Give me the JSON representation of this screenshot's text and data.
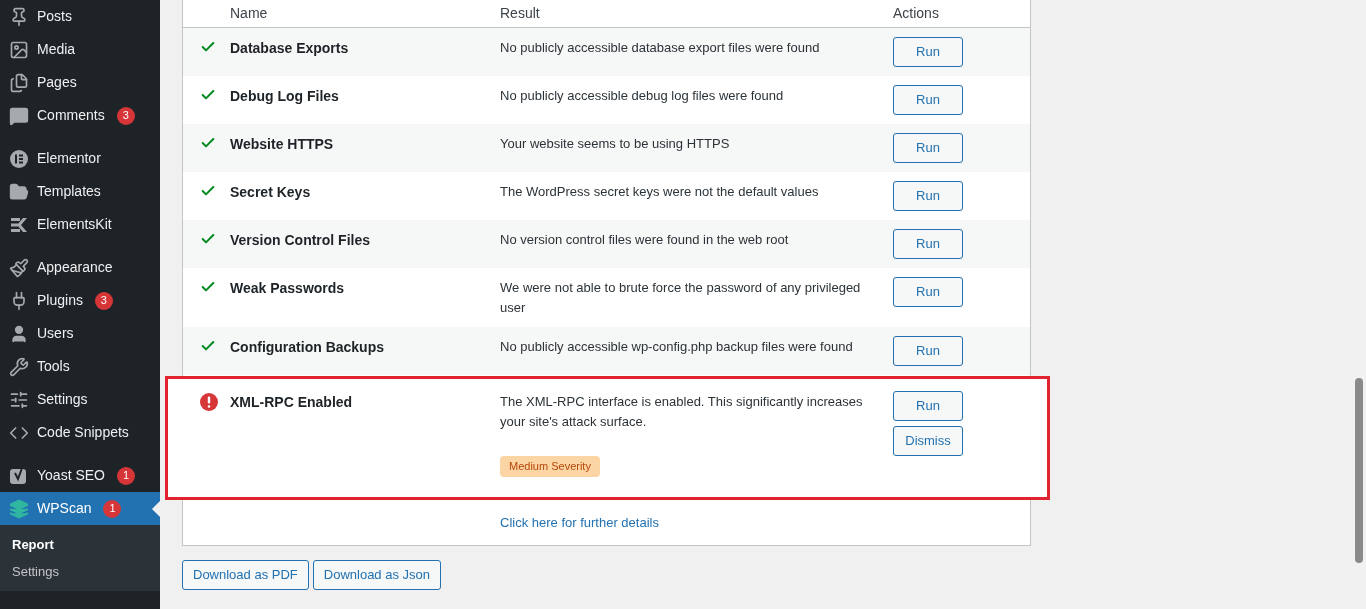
{
  "sidebar": {
    "groups": [
      {
        "items": [
          {
            "label": "Posts",
            "selected": false
          },
          {
            "label": "Media",
            "selected": false
          },
          {
            "label": "Pages",
            "selected": false
          },
          {
            "label": "Comments",
            "badge": "3",
            "selected": false
          }
        ]
      },
      {
        "items": [
          {
            "label": "Elementor",
            "selected": false
          },
          {
            "label": "Templates",
            "selected": false
          },
          {
            "label": "ElementsKit",
            "selected": false
          }
        ]
      },
      {
        "items": [
          {
            "label": "Appearance",
            "selected": false
          },
          {
            "label": "Plugins",
            "badge": "3",
            "selected": false
          },
          {
            "label": "Users",
            "selected": false
          },
          {
            "label": "Tools",
            "selected": false
          },
          {
            "label": "Settings",
            "selected": false
          },
          {
            "label": "Code Snippets",
            "selected": false
          }
        ]
      },
      {
        "items": [
          {
            "label": "Yoast SEO",
            "badge": "1",
            "selected": false
          },
          {
            "label": "WPScan",
            "badge": "1",
            "selected": true
          }
        ]
      }
    ],
    "submenu": [
      {
        "label": "Report",
        "selected": true
      },
      {
        "label": "Settings",
        "selected": false
      }
    ]
  },
  "table": {
    "columns": [
      "Name",
      "Result",
      "Actions"
    ],
    "rows": [
      {
        "kind": "pass",
        "name": "Database Exports",
        "result": "No publicly accessible database export files were found",
        "actions": [
          "Run"
        ],
        "highlighted": false
      },
      {
        "kind": "pass",
        "name": "Debug Log Files",
        "result": "No publicly accessible debug log files were found",
        "actions": [
          "Run"
        ],
        "highlighted": false
      },
      {
        "kind": "pass",
        "name": "Website HTTPS",
        "result": "Your website seems to be using HTTPS",
        "actions": [
          "Run"
        ],
        "highlighted": false
      },
      {
        "kind": "pass",
        "name": "Secret Keys",
        "result": "The WordPress secret keys were not the default values",
        "actions": [
          "Run"
        ],
        "highlighted": false
      },
      {
        "kind": "pass",
        "name": "Version Control Files",
        "result": "No version control files were found in the web root",
        "actions": [
          "Run"
        ],
        "highlighted": false
      },
      {
        "kind": "pass",
        "name": "Weak Passwords",
        "result": "We were not able to brute force the password of any privileged user",
        "actions": [
          "Run"
        ],
        "highlighted": false
      },
      {
        "kind": "pass",
        "name": "Configuration Backups",
        "result": "No publicly accessible wp-config.php backup files were found",
        "actions": [
          "Run"
        ],
        "highlighted": false
      },
      {
        "kind": "fail",
        "name": "XML-RPC Enabled",
        "result": "The XML-RPC interface is enabled. This significantly increases your site's attack surface.",
        "severity": "Medium Severity",
        "actions": [
          "Run",
          "Dismiss"
        ],
        "highlighted": true
      }
    ],
    "details_link": "Click here for further details"
  },
  "downloads": [
    "Download as PDF",
    "Download as Json"
  ]
}
